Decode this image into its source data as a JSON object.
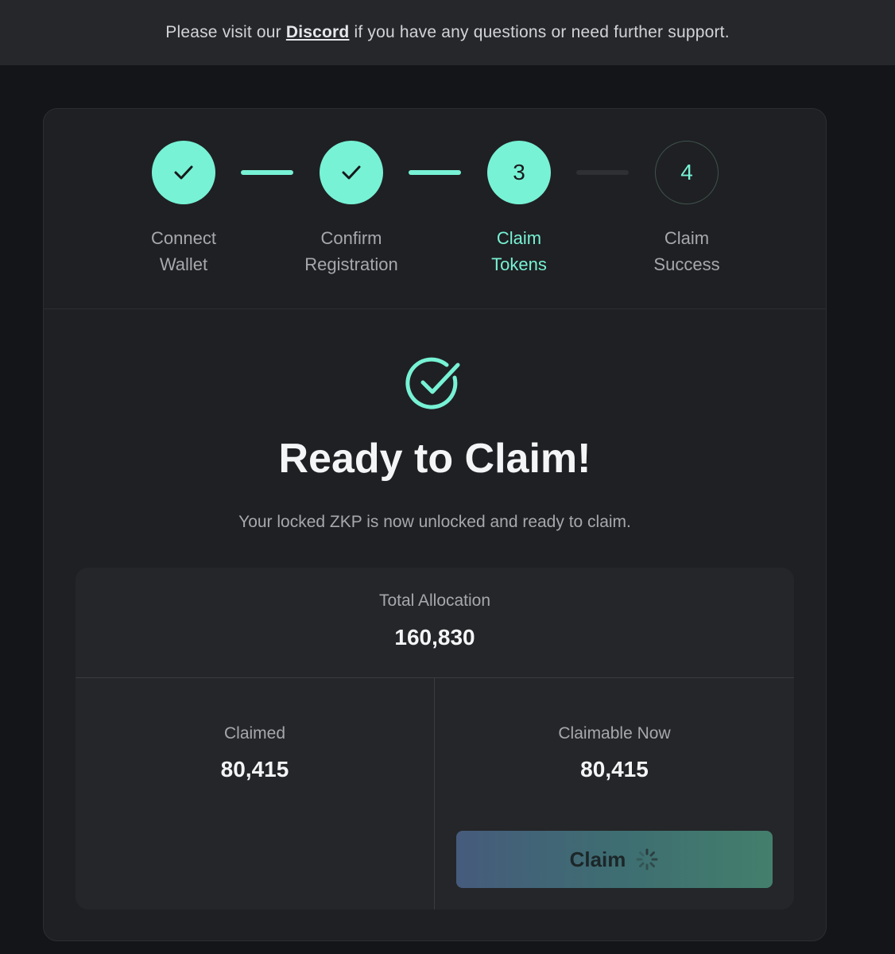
{
  "banner": {
    "prefix": "Please visit our",
    "link": "Discord",
    "suffix": "if you have any questions or need further support."
  },
  "steps": [
    {
      "label": "Connect\nWallet",
      "status": "done",
      "icon": "check-icon"
    },
    {
      "label": "Confirm\nRegistration",
      "status": "done",
      "icon": "check-icon"
    },
    {
      "label": "Claim\nTokens",
      "status": "active",
      "number": "3"
    },
    {
      "label": "Claim\nSuccess",
      "status": "pending",
      "number": "4"
    }
  ],
  "hero": {
    "icon": "check-circle-icon",
    "title": "Ready to Claim!",
    "subtitle": "Your locked ZKP is now unlocked and ready to claim."
  },
  "allocation": {
    "total_label": "Total Allocation",
    "total_value": "160,830",
    "claimed_label": "Claimed",
    "claimed_value": "80,415",
    "claimable_label": "Claimable Now",
    "claimable_value": "80,415",
    "claim_button": "Claim",
    "claim_button_state": "loading"
  },
  "colors": {
    "accent": "#77f2d5",
    "background": "#141518",
    "card": "#1f2023",
    "banner": "#26272b"
  }
}
